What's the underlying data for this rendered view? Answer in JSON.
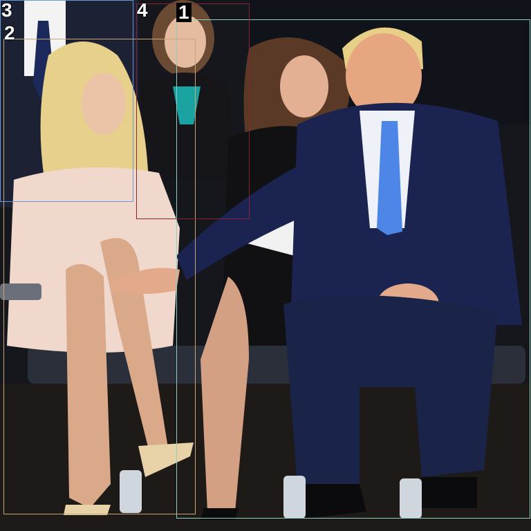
{
  "image": {
    "description_icon": "photo-scene",
    "palette": {
      "background": "#15171c",
      "suit": "#1b2450",
      "dress": "#f1d8cc",
      "skin": "#d9a98a",
      "hair_blonde": "#e7cf8c",
      "hair_brown": "#5a3a26",
      "tie_blue": "#4d86e6",
      "chair": "#2b2f3a",
      "floor": "#1d1a18"
    }
  },
  "annotations": {
    "boxes": [
      {
        "label": "1",
        "color": "#8fd1c1"
      },
      {
        "label": "2",
        "color": "#c9a67a"
      },
      {
        "label": "3",
        "color": "#6a9ad6"
      },
      {
        "label": "4",
        "color": "#8a2233"
      }
    ]
  }
}
